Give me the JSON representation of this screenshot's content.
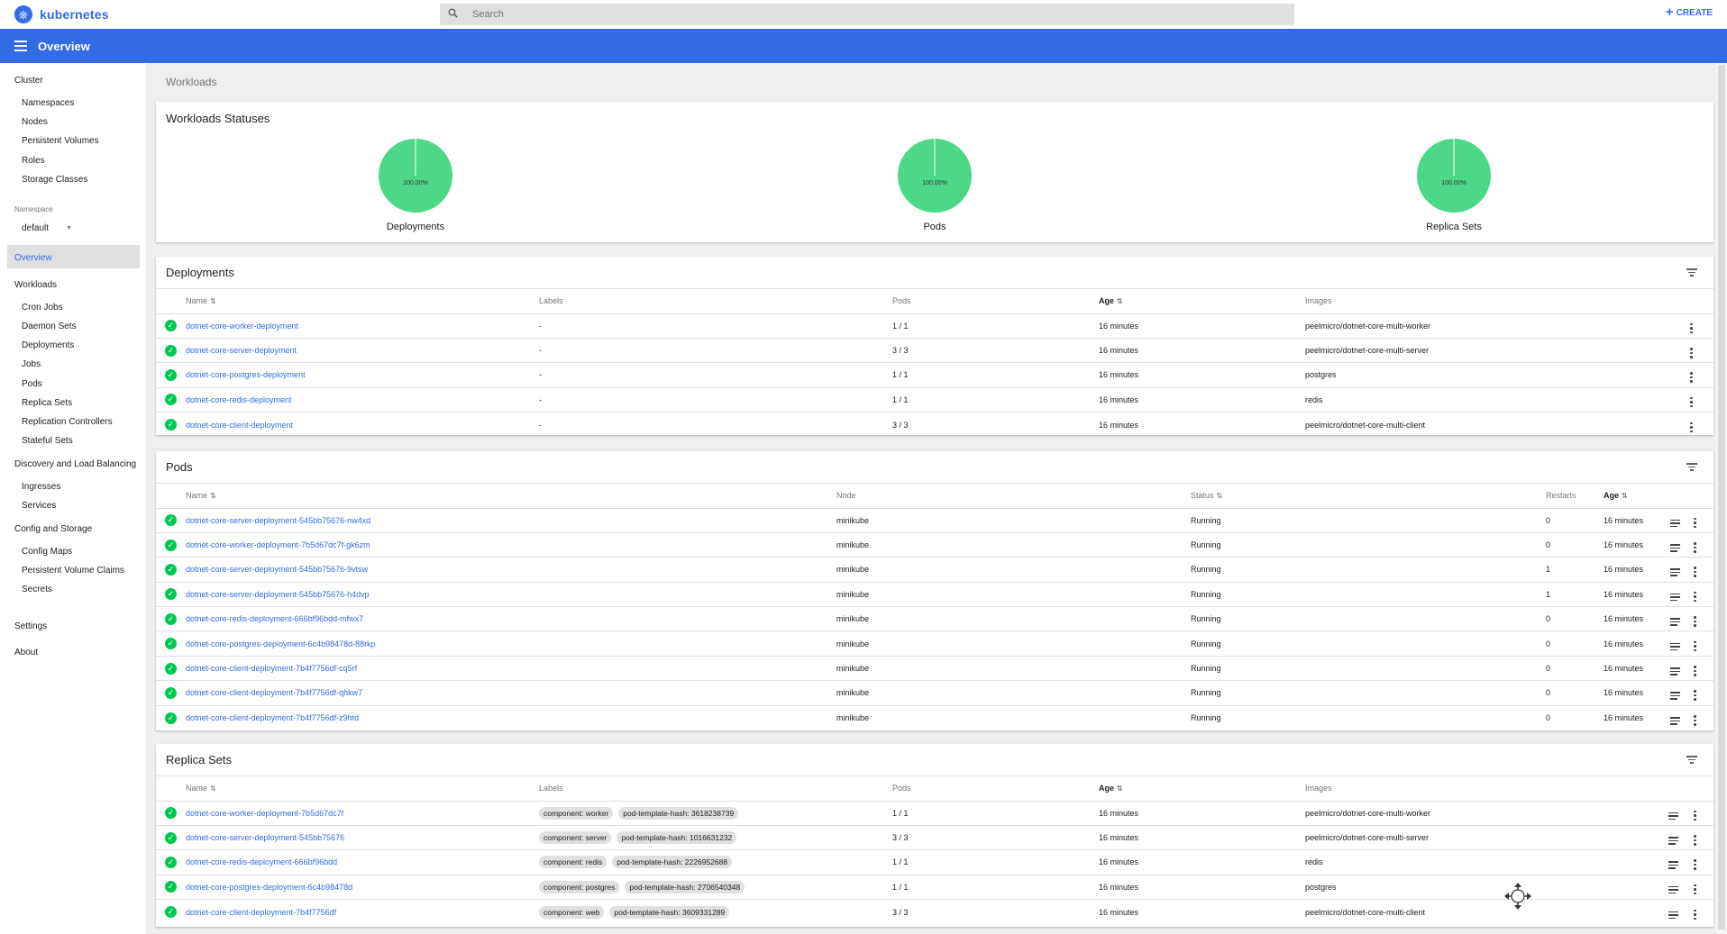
{
  "topbar": {
    "logo_text": "kubernetes",
    "search_placeholder": "Search",
    "create_label": "CREATE"
  },
  "appbar": {
    "title": "Overview"
  },
  "sidebar": {
    "cluster_label": "Cluster",
    "cluster_items": [
      "Namespaces",
      "Nodes",
      "Persistent Volumes",
      "Roles",
      "Storage Classes"
    ],
    "namespace_label": "Namespace",
    "namespace_value": "default",
    "overview_label": "Overview",
    "workloads_label": "Workloads",
    "workloads_items": [
      "Cron Jobs",
      "Daemon Sets",
      "Deployments",
      "Jobs",
      "Pods",
      "Replica Sets",
      "Replication Controllers",
      "Stateful Sets"
    ],
    "discovery_label": "Discovery and Load Balancing",
    "discovery_items": [
      "Ingresses",
      "Services"
    ],
    "config_label": "Config and Storage",
    "config_items": [
      "Config Maps",
      "Persistent Volume Claims",
      "Secrets"
    ],
    "settings_label": "Settings",
    "about_label": "About"
  },
  "breadcrumb": "Workloads",
  "statuses": {
    "title": "Workloads Statuses",
    "charts": [
      {
        "label": "Deployments",
        "value_text": "100.00%",
        "success_fraction": 1.0
      },
      {
        "label": "Pods",
        "value_text": "100.00%",
        "success_fraction": 1.0
      },
      {
        "label": "Replica Sets",
        "value_text": "100.00%",
        "success_fraction": 1.0
      }
    ],
    "success_color": "#4cd886"
  },
  "deployments": {
    "title": "Deployments",
    "headers": {
      "name": "Name",
      "labels": "Labels",
      "pods": "Pods",
      "age": "Age",
      "images": "Images"
    },
    "rows": [
      {
        "name": "dotnet-core-worker-deployment",
        "labels": "-",
        "pods": "1 / 1",
        "age": "16 minutes",
        "images": "peelmicro/dotnet-core-multi-worker"
      },
      {
        "name": "dotnet-core-server-deployment",
        "labels": "-",
        "pods": "3 / 3",
        "age": "16 minutes",
        "images": "peelmicro/dotnet-core-multi-server"
      },
      {
        "name": "dotnet-core-postgres-deployment",
        "labels": "-",
        "pods": "1 / 1",
        "age": "16 minutes",
        "images": "postgres"
      },
      {
        "name": "dotnet-core-redis-deployment",
        "labels": "-",
        "pods": "1 / 1",
        "age": "16 minutes",
        "images": "redis"
      },
      {
        "name": "dotnet-core-client-deployment",
        "labels": "-",
        "pods": "3 / 3",
        "age": "16 minutes",
        "images": "peelmicro/dotnet-core-multi-client"
      }
    ]
  },
  "pods": {
    "title": "Pods",
    "headers": {
      "name": "Name",
      "node": "Node",
      "status": "Status",
      "restarts": "Restarts",
      "age": "Age"
    },
    "rows": [
      {
        "name": "dotnet-core-server-deployment-545bb75676-nw4xd",
        "node": "minikube",
        "status": "Running",
        "restarts": "0",
        "age": "16 minutes"
      },
      {
        "name": "dotnet-core-worker-deployment-7b5d67dc7f-gk6zm",
        "node": "minikube",
        "status": "Running",
        "restarts": "0",
        "age": "16 minutes"
      },
      {
        "name": "dotnet-core-server-deployment-545bb75676-9vtsw",
        "node": "minikube",
        "status": "Running",
        "restarts": "1",
        "age": "16 minutes"
      },
      {
        "name": "dotnet-core-server-deployment-545bb75676-h4dvp",
        "node": "minikube",
        "status": "Running",
        "restarts": "1",
        "age": "16 minutes"
      },
      {
        "name": "dotnet-core-redis-deployment-666bf96bdd-mfwx7",
        "node": "minikube",
        "status": "Running",
        "restarts": "0",
        "age": "16 minutes"
      },
      {
        "name": "dotnet-core-postgres-deployment-6c4b98478d-88rkp",
        "node": "minikube",
        "status": "Running",
        "restarts": "0",
        "age": "16 minutes"
      },
      {
        "name": "dotnet-core-client-deployment-7b4f7756df-cq5rf",
        "node": "minikube",
        "status": "Running",
        "restarts": "0",
        "age": "16 minutes"
      },
      {
        "name": "dotnet-core-client-deployment-7b4f7756df-qhkw7",
        "node": "minikube",
        "status": "Running",
        "restarts": "0",
        "age": "16 minutes"
      },
      {
        "name": "dotnet-core-client-deployment-7b4f7756df-z9htd",
        "node": "minikube",
        "status": "Running",
        "restarts": "0",
        "age": "16 minutes"
      }
    ]
  },
  "replicasets": {
    "title": "Replica Sets",
    "headers": {
      "name": "Name",
      "labels": "Labels",
      "pods": "Pods",
      "age": "Age",
      "images": "Images"
    },
    "rows": [
      {
        "name": "dotnet-core-worker-deployment-7b5d67dc7f",
        "labels": [
          "component: worker",
          "pod-template-hash: 3618238739"
        ],
        "pods": "1 / 1",
        "age": "16 minutes",
        "images": "peelmicro/dotnet-core-multi-worker"
      },
      {
        "name": "dotnet-core-server-deployment-545bb75676",
        "labels": [
          "component: server",
          "pod-template-hash: 1016631232"
        ],
        "pods": "3 / 3",
        "age": "16 minutes",
        "images": "peelmicro/dotnet-core-multi-server"
      },
      {
        "name": "dotnet-core-redis-deployment-666bf96bdd",
        "labels": [
          "component: redis",
          "pod-template-hash: 2226952688"
        ],
        "pods": "1 / 1",
        "age": "16 minutes",
        "images": "redis"
      },
      {
        "name": "dotnet-core-postgres-deployment-6c4b98478d",
        "labels": [
          "component: postgres",
          "pod-template-hash: 2706540348"
        ],
        "pods": "1 / 1",
        "age": "16 minutes",
        "images": "postgres"
      },
      {
        "name": "dotnet-core-client-deployment-7b4f7756df",
        "labels": [
          "component: web",
          "pod-template-hash: 3609331289"
        ],
        "pods": "3 / 3",
        "age": "16 minutes",
        "images": "peelmicro/dotnet-core-multi-client"
      }
    ]
  }
}
